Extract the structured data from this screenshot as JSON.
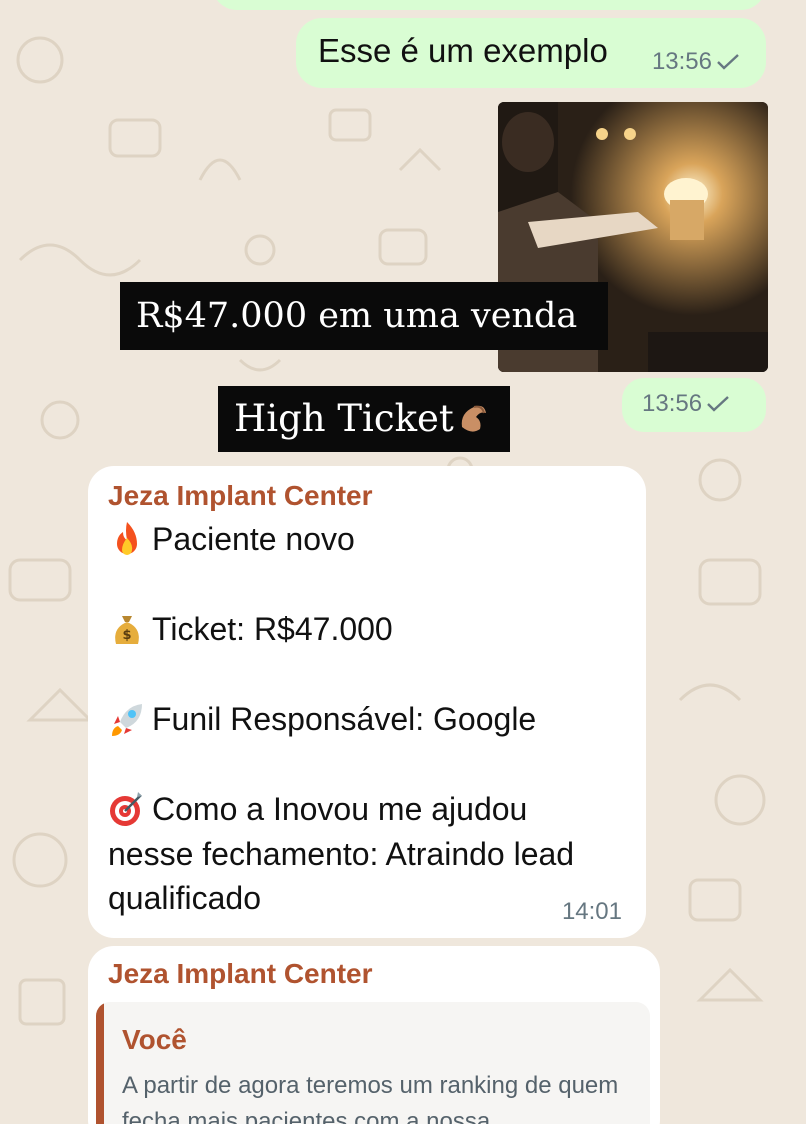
{
  "outgoing_example": {
    "text": "Esse é um exemplo",
    "time": "13:56"
  },
  "image_message": {
    "caption_line1": "R$47.000 em uma venda",
    "caption_line2": "High Ticket",
    "time": "13:56"
  },
  "incoming_1": {
    "sender": "Jeza Implant Center",
    "lines": {
      "l1": "Paciente novo",
      "l2": "Ticket: R$47.000",
      "l3": "Funil Responsável: Google",
      "l4a": "Como a Inovou me ajudou",
      "l4b": "nesse fechamento: Atraindo lead",
      "l4c": "qualificado"
    },
    "icons": [
      "fire-emoji",
      "money-bag-emoji",
      "rocket-emoji",
      "target-emoji"
    ],
    "time": "14:01"
  },
  "incoming_2": {
    "sender": "Jeza Implant Center",
    "quote_author": "Você",
    "quote_text": "A partir de agora teremos um ranking de quem fecha mais pacientes com a nossa"
  },
  "colors": {
    "outgoing_bubble": "#d9fdd3",
    "incoming_bubble": "#ffffff",
    "sender_name": "#b0532f",
    "wallpaper": "#efe7dc"
  }
}
